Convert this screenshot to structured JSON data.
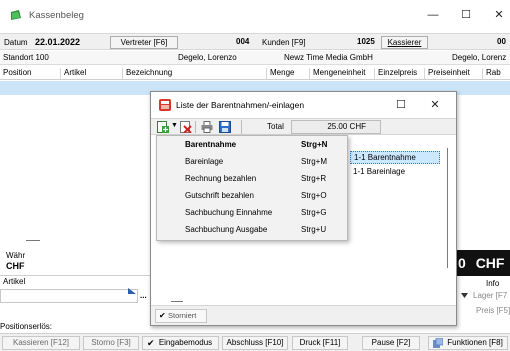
{
  "window": {
    "title": "Kassenbeleg",
    "controls": {
      "minimize": "—",
      "maximize": "☐",
      "close": "✕"
    }
  },
  "header": {
    "datum_label": "Datum",
    "datum_value": "22.01.2022",
    "vertreter_button": "Vertreter [F6]",
    "vertreter_nr": "004",
    "kunden_label": "Kunden [F9]",
    "kunden_nr": "1025",
    "kassierer_button": "Kassierer",
    "kassierer_nr": "00",
    "standort_label": "Standort 100",
    "vertreter_name": "Degelo, Lorenzo",
    "kunden_name": "Newz Time Media GmbH",
    "kassierer_name": "Degelo, Lorenz"
  },
  "table": {
    "columns": [
      "Position",
      "Artikel",
      "Bezeichnung",
      "Menge",
      "Mengeneinheit",
      "Einzelpreis",
      "Preiseinheit",
      "Rab"
    ]
  },
  "lower": {
    "waehr_label": "Währ",
    "waehr_value": "CHF",
    "artikel_label": "Artikel",
    "ellipsis": "...",
    "positionserloes_label": "Positionserlös:",
    "total_currency": "CHF",
    "info_label": "Info",
    "lager_button": "Lager [F7",
    "preis_button": "Preis [F5]",
    "zero": "0"
  },
  "bottom_buttons": [
    {
      "label": "Kassieren [F12]",
      "enabled": false
    },
    {
      "label": "Storno [F3]",
      "enabled": false
    },
    {
      "label": "Eingabemodus",
      "enabled": true,
      "checked": true
    },
    {
      "label": "Abschluss [F10]",
      "enabled": true
    },
    {
      "label": "Druck [F11]",
      "enabled": true
    },
    {
      "label": "Pause [F2]",
      "enabled": true
    },
    {
      "label": "Funktionen [F8]",
      "enabled": true
    }
  ],
  "dialog": {
    "title": "Liste der Barentnahmen/-einlagen",
    "total_label": "Total",
    "total_value": "25.00 CHF",
    "list_items": [
      "1-1 Barentnahme",
      "1-1 Bareinlage"
    ],
    "storniert_label": "Storniert",
    "storniert_checked": true
  },
  "menu": {
    "items": [
      {
        "label": "Barentnahme",
        "shortcut": "Strg+N",
        "bold": true
      },
      {
        "label": "Bareinlage",
        "shortcut": "Strg+M"
      },
      {
        "label": "Rechnung bezahlen",
        "shortcut": "Strg+R"
      },
      {
        "label": "Gutschrift bezahlen",
        "shortcut": "Strg+O"
      },
      {
        "label": "Sachbuchung Einnahme",
        "shortcut": "Strg+G"
      },
      {
        "label": "Sachbuchung Ausgabe",
        "shortcut": "Strg+U"
      }
    ]
  },
  "colors": {
    "selection": "#cce4f7",
    "list_selection": "#cce8ff",
    "dialog_border": "#8a8a8a"
  }
}
